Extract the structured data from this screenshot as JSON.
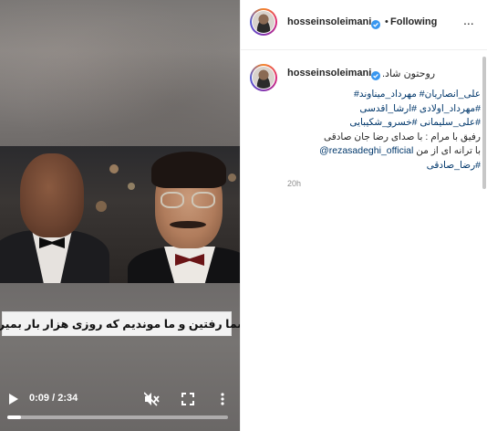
{
  "video": {
    "subtitle": "شما رفتین و  ما موندیم  که روزی هزار بار بمیریم",
    "time_current": "0:09",
    "time_total": "2:34",
    "time_separator": " / ",
    "progress": 0.06,
    "icons": {
      "play": "play-icon",
      "mute": "muted-speaker-icon",
      "fullscreen": "fullscreen-icon",
      "more": "more-vertical-icon"
    }
  },
  "header": {
    "username": "hosseinsoleimani",
    "separator": "•",
    "follow_status": "Following",
    "options": "..."
  },
  "caption": {
    "username": "hosseinsoleimani",
    "first_line": "روحتون شاد.",
    "lines": [
      {
        "tags": "علی_انصاریان# مهرداد_میناوند#",
        "text": ""
      },
      {
        "tags": "#مهرداد_اولادی #ارشا_اقدسی",
        "text": ""
      },
      {
        "tags": "#علی_سلیمانی #خسرو_شکیبایی",
        "text": ""
      },
      {
        "tags": "",
        "text": "رفیق با مرام : با صدای رضا جان صادقی"
      },
      {
        "mention": "@rezasadeghi_official",
        "text": " با ترانه ای از من"
      },
      {
        "tags": "#رضا_صادقی",
        "text": ""
      }
    ],
    "timestamp": "20h"
  },
  "colors": {
    "link": "#00376b",
    "verified": "#3897f0",
    "muted_text": "#8e8e8e"
  }
}
